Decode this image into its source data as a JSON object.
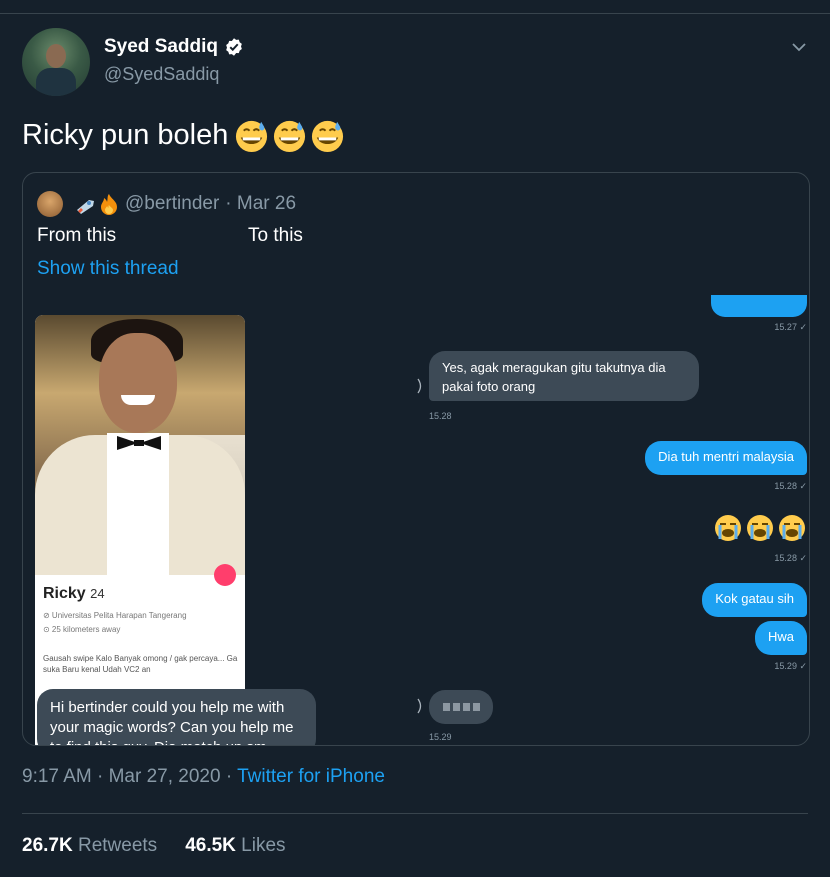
{
  "author": {
    "name": "Syed Saddiq",
    "handle": "@SyedSaddiq"
  },
  "tweet": {
    "text": "Ricky pun boleh",
    "emojis": [
      "grinning-face-with-sweat",
      "grinning-face-with-sweat",
      "grinning-face-with-sweat"
    ]
  },
  "quote": {
    "handle": "@bertinder",
    "date": "· Mar 26",
    "from_label": "From this",
    "to_label": "To this",
    "show_thread": "Show this thread",
    "profile_card": {
      "name": "Ricky",
      "age": "24",
      "school": "⊘ Universitas Pelita Harapan Tangerang",
      "distance": "⊙ 25 kilometers away",
      "bio": "Gausah swipe Kalo Banyak omong / gak percaya... Ga suka Baru kenal Udah VC2 an"
    },
    "left_bubble": "Hi bertinder could you help me with your magic words? Can you help me to find this guy. Dia match up sm",
    "chat": {
      "top_time": "15.27 ✓",
      "msg1": "Yes, agak meragukan gitu takutnya dia pakai foto orang",
      "msg1_time": "15.28",
      "msg2": "Dia tuh mentri malaysia",
      "msg2_time": "15.28 ✓",
      "cry_time": "15.28 ✓",
      "msg3": "Kok gatau sih",
      "msg4": "Hwa",
      "msg4_time": "15.29 ✓",
      "blur_time": "15.29"
    }
  },
  "meta": {
    "time_date": "9:17 AM · Mar 27, 2020 · ",
    "source": "Twitter for iPhone"
  },
  "stats": {
    "retweets_count": "26.7K",
    "retweets_label": "Retweets",
    "likes_count": "46.5K",
    "likes_label": "Likes"
  }
}
